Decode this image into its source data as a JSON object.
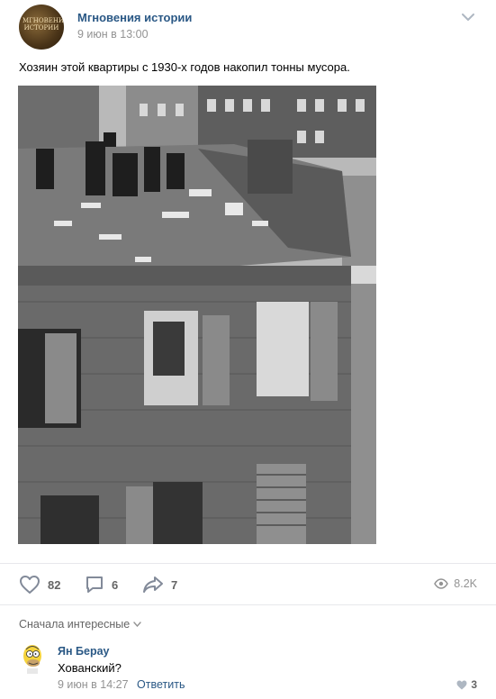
{
  "post": {
    "author": "Мгновения истории",
    "date": "9 июн в 13:00",
    "avatar_text": "МГНОВЕНИЯ ИСТОРИИ",
    "text": "Хозяин этой квартиры с 1930-х годов накопил тонны мусора.",
    "photo_icon": "black-and-white-photo"
  },
  "actions": {
    "likes": "82",
    "comments": "6",
    "shares": "7",
    "views": "8.2K"
  },
  "comments": {
    "sort_label": "Сначала интересные",
    "items": [
      {
        "author": "Ян Берау",
        "text": "Хованский?",
        "date": "9 июн в 14:27",
        "reply_label": "Ответить",
        "likes": "3",
        "avatar_icon": "homer-simpson-avatar"
      }
    ]
  },
  "colors": {
    "link": "#2a5885",
    "muted": "#939393",
    "icon": "#828a99",
    "divider": "#e7e8ec"
  }
}
